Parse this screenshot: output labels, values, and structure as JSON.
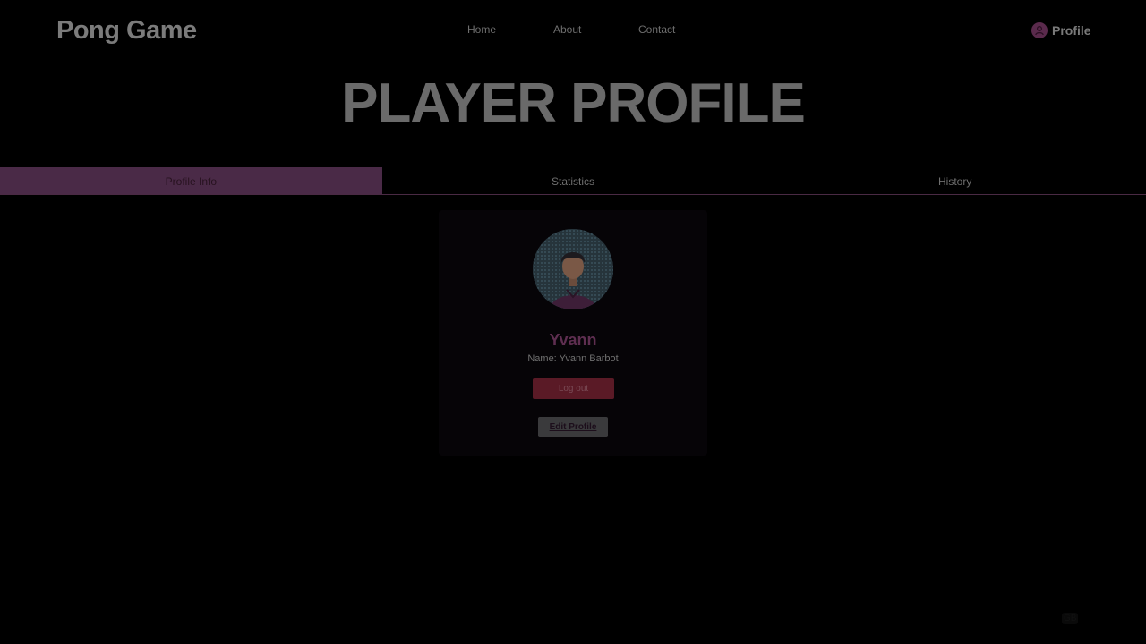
{
  "header": {
    "brand": "Pong Game",
    "nav": [
      {
        "label": "Home"
      },
      {
        "label": "About"
      },
      {
        "label": "Contact"
      }
    ],
    "profile_label": "Profile",
    "profile_icon": "user-circle-icon"
  },
  "page_title": "PLAYER PROFILE",
  "tabs": [
    {
      "label": "Profile Info",
      "active": true
    },
    {
      "label": "Statistics",
      "active": false
    },
    {
      "label": "History",
      "active": false
    }
  ],
  "card": {
    "avatar_icon": "avatar-illustration",
    "username": "Yvann",
    "name_text": "Name: Yvann Barbot",
    "logout_label": "Log out",
    "edit_label": "Edit Profile"
  },
  "language": "GB",
  "colors": {
    "background": "#000000",
    "accent": "#4a2a47",
    "username": "#5e2e50",
    "logout": "#5a1a26"
  }
}
